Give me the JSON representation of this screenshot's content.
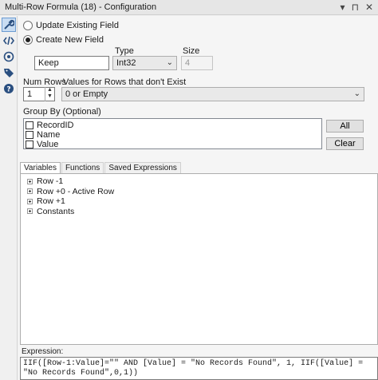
{
  "window": {
    "title": "Multi-Row Formula (18) - Configuration",
    "controls": [
      "▾",
      "⊓",
      "✕"
    ]
  },
  "leftbar": {
    "icons": [
      "wrench-icon",
      "code-icon",
      "globe-icon",
      "tag-icon",
      "help-icon"
    ]
  },
  "update_existing": {
    "label": "Update Existing Field",
    "selected": false
  },
  "create_new": {
    "label": "Create New  Field",
    "selected": true
  },
  "new_field": {
    "type_label": "Type",
    "size_label": "Size",
    "name_value": "Keep",
    "type_value": "Int32",
    "size_value": "4"
  },
  "num_rows": {
    "label": "Num Rows",
    "value": "1"
  },
  "nonexist": {
    "label": "Values for Rows that don't Exist",
    "value": "0 or Empty"
  },
  "group_by": {
    "label": "Group By (Optional)",
    "fields": [
      "RecordID",
      "Name",
      "Value"
    ],
    "all_button": "All",
    "clear_button": "Clear"
  },
  "tabs": [
    "Variables",
    "Functions",
    "Saved Expressions"
  ],
  "tree": [
    "Row -1",
    "Row +0 - Active Row",
    "Row +1",
    "Constants"
  ],
  "expression": {
    "label": "Expression:",
    "text": "IIF([Row-1:Value]=\"\" AND [Value] = \"No Records Found\", 1, IIF([Value] = \"No Records Found\",0,1))"
  }
}
